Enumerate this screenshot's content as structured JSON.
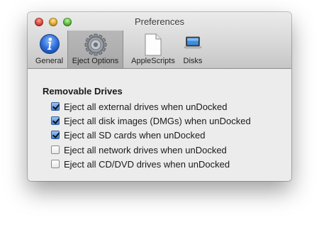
{
  "window": {
    "title": "Preferences"
  },
  "toolbar": {
    "items": [
      {
        "label": "General",
        "icon": "info-icon",
        "selected": false
      },
      {
        "label": "Eject Options",
        "icon": "gear-icon",
        "selected": true
      },
      {
        "label": "AppleScripts",
        "icon": "document-icon",
        "selected": false
      },
      {
        "label": "Disks",
        "icon": "laptop-icon",
        "selected": false
      }
    ]
  },
  "main": {
    "section_title": "Removable Drives",
    "options": [
      {
        "label": "Eject all external drives when unDocked",
        "checked": true
      },
      {
        "label": "Eject all disk images (DMGs) when unDocked",
        "checked": true
      },
      {
        "label": "Eject all SD cards when unDocked",
        "checked": true
      },
      {
        "label": "Eject all network drives when unDocked",
        "checked": false
      },
      {
        "label": "Eject all CD/DVD drives when unDocked",
        "checked": false
      }
    ]
  },
  "colors": {
    "checkbox_accent": "#3f7fd4",
    "info_icon_blue": "#2f6fd8"
  }
}
